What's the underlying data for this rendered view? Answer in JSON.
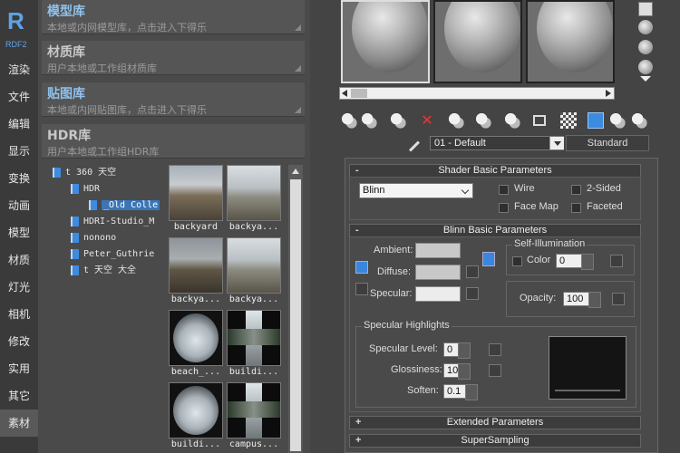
{
  "app": {
    "logo_letter": "R",
    "logo_sub": "RDF2"
  },
  "nav": {
    "items": [
      {
        "label": "渲染"
      },
      {
        "label": "文件"
      },
      {
        "label": "编辑"
      },
      {
        "label": "显示"
      },
      {
        "label": "变换"
      },
      {
        "label": "动画"
      },
      {
        "label": "模型"
      },
      {
        "label": "材质"
      },
      {
        "label": "灯光"
      },
      {
        "label": "相机"
      },
      {
        "label": "修改"
      },
      {
        "label": "实用"
      },
      {
        "label": "其它"
      },
      {
        "label": "素材",
        "active": true
      }
    ]
  },
  "library": {
    "sections": [
      {
        "title": "模型库",
        "subtitle": "本地或内网模型库，点击进入下得乐",
        "highlight": true
      },
      {
        "title": "材质库",
        "subtitle": "用户本地或工作组材质库",
        "highlight": false
      },
      {
        "title": "贴图库",
        "subtitle": "本地或内网贴图库，点击进入下得乐",
        "highlight": true
      },
      {
        "title": "HDR库",
        "subtitle": "用户本地或工作组HDR库",
        "highlight": false
      }
    ],
    "tree": [
      {
        "label": "t 360 天空",
        "indent": 0
      },
      {
        "label": "HDR",
        "indent": 1
      },
      {
        "label": "_Old Colle",
        "indent": 2,
        "selected": true
      },
      {
        "label": "HDRI-Studio_M",
        "indent": 1
      },
      {
        "label": "nonono",
        "indent": 1
      },
      {
        "label": "Peter_Guthrie",
        "indent": 1
      },
      {
        "label": "t 天空 大全",
        "indent": 1
      }
    ],
    "thumbnails": [
      {
        "caption": "backyard",
        "kind": "pano"
      },
      {
        "caption": "backya...",
        "kind": "pano b"
      },
      {
        "caption": "backya...",
        "kind": "pano c"
      },
      {
        "caption": "backya...",
        "kind": "pano b"
      },
      {
        "caption": "beach_...",
        "kind": "fish"
      },
      {
        "caption": "buildi...",
        "kind": "cross"
      },
      {
        "caption": "buildi...",
        "kind": "fish"
      },
      {
        "caption": "campus...",
        "kind": "cross"
      }
    ]
  },
  "material_editor": {
    "material_name": "01 - Default",
    "material_type": "Standard",
    "rollouts": {
      "shader_basic": {
        "title": "Shader Basic Parameters",
        "toggle": "-",
        "shader": "Blinn",
        "wire": "Wire",
        "two_sided": "2-Sided",
        "face_map": "Face Map",
        "faceted": "Faceted"
      },
      "blinn_basic": {
        "title": "Blinn Basic Parameters",
        "toggle": "-",
        "ambient": "Ambient:",
        "diffuse": "Diffuse:",
        "specular": "Specular:",
        "self_illum_title": "Self-Illumination",
        "color_label": "Color",
        "color_value": "0",
        "opacity_label": "Opacity:",
        "opacity_value": "100",
        "spec_highlights_title": "Specular Highlights",
        "spec_level_label": "Specular Level:",
        "spec_level_value": "0",
        "glossiness_label": "Glossiness:",
        "glossiness_value": "10",
        "soften_label": "Soften:",
        "soften_value": "0.1"
      },
      "extended": {
        "title": "Extended Parameters",
        "toggle": "+"
      },
      "supersampling": {
        "title": "SuperSampling",
        "toggle": "+"
      }
    }
  },
  "colors": {
    "accent": "#3c8be0",
    "title_blue": "#8fc1ec",
    "panel_bg": "#444444"
  }
}
